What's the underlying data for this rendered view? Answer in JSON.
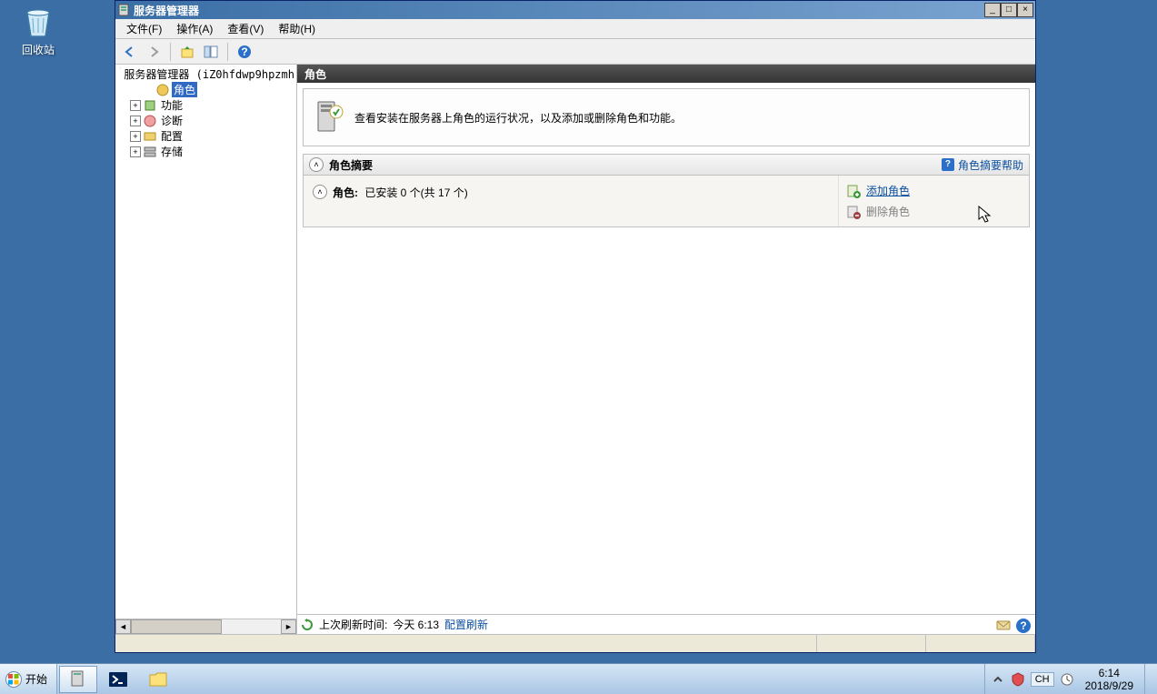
{
  "desktop": {
    "recycle_bin": "回收站"
  },
  "window": {
    "title": "服务器管理器",
    "menus": {
      "file": "文件(F)",
      "action": "操作(A)",
      "view": "查看(V)",
      "help": "帮助(H)"
    },
    "toolbar": {
      "back": "back",
      "forward": "forward",
      "up": "up",
      "props": "properties",
      "help": "help"
    },
    "tree": {
      "root": "服务器管理器 (iZ0hfdwp9hpzmh",
      "roles": "角色",
      "features": "功能",
      "diagnostics": "诊断",
      "configuration": "配置",
      "storage": "存储"
    }
  },
  "content": {
    "header": "角色",
    "banner": "查看安装在服务器上角色的运行状况，以及添加或删除角色和功能。",
    "summary_title": "角色摘要",
    "summary_help": "角色摘要帮助",
    "roles_label": "角色:",
    "roles_status": "已安装 0 个(共 17 个)",
    "add_role": "添加角色",
    "remove_role": "删除角色",
    "last_refresh_label": "上次刷新时间:",
    "last_refresh_value": "今天 6:13",
    "config_refresh": "配置刷新"
  },
  "taskbar": {
    "start": "开始",
    "lang": "CH",
    "clock_time": "6:14",
    "clock_date": "2018/9/29"
  }
}
